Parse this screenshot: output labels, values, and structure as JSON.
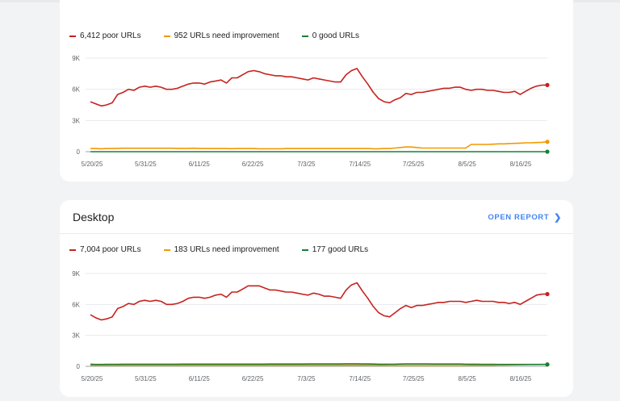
{
  "charts": [
    {
      "id": "mobile",
      "legend": [
        {
          "label": "6,412 poor URLs",
          "color": "#c5221f"
        },
        {
          "label": "952 URLs need improvement",
          "color": "#f29900"
        },
        {
          "label": "0 good URLs",
          "color": "#188038"
        }
      ]
    },
    {
      "id": "desktop",
      "title": "Desktop",
      "open_report": "OPEN REPORT",
      "legend": [
        {
          "label": "7,004 poor URLs",
          "color": "#c5221f"
        },
        {
          "label": "183 URLs need improvement",
          "color": "#f29900"
        },
        {
          "label": "177 good URLs",
          "color": "#188038"
        }
      ]
    }
  ],
  "chart_data": [
    {
      "type": "line",
      "x_ticks": [
        "5/20/25",
        "5/31/25",
        "6/11/25",
        "6/22/25",
        "7/3/25",
        "7/14/25",
        "7/25/25",
        "8/5/25",
        "8/16/25"
      ],
      "y_ticks": [
        "0",
        "3K",
        "6K",
        "9K"
      ],
      "ylim": [
        0,
        9000
      ],
      "series": [
        {
          "name": "6,412 poor URLs",
          "color": "#c5221f",
          "values": [
            4800,
            4600,
            4400,
            4500,
            4700,
            5500,
            5700,
            6000,
            5900,
            6200,
            6300,
            6200,
            6300,
            6200,
            6000,
            6000,
            6100,
            6300,
            6500,
            6600,
            6600,
            6500,
            6700,
            6800,
            6900,
            6600,
            7100,
            7100,
            7400,
            7700,
            7800,
            7700,
            7500,
            7400,
            7300,
            7300,
            7200,
            7200,
            7100,
            7000,
            6900,
            7100,
            7000,
            6900,
            6800,
            6700,
            6700,
            7400,
            7800,
            8000,
            7200,
            6500,
            5700,
            5100,
            4800,
            4700,
            5000,
            5200,
            5600,
            5500,
            5700,
            5700,
            5800,
            5900,
            6000,
            6100,
            6100,
            6200,
            6200,
            6000,
            5900,
            6000,
            6000,
            5900,
            5900,
            5800,
            5700,
            5700,
            5800,
            5500,
            5800,
            6100,
            6300,
            6400,
            6412
          ]
        },
        {
          "name": "952 URLs need improvement",
          "color": "#f29900",
          "values": [
            300,
            300,
            280,
            300,
            300,
            320,
            330,
            330,
            330,
            330,
            330,
            330,
            330,
            330,
            330,
            330,
            320,
            320,
            320,
            330,
            320,
            300,
            300,
            300,
            300,
            300,
            290,
            300,
            300,
            300,
            300,
            280,
            280,
            280,
            280,
            280,
            300,
            300,
            300,
            300,
            300,
            300,
            300,
            300,
            300,
            300,
            300,
            300,
            300,
            300,
            300,
            300,
            280,
            280,
            300,
            300,
            350,
            400,
            450,
            450,
            400,
            350,
            350,
            350,
            350,
            350,
            350,
            350,
            350,
            350,
            700,
            700,
            700,
            700,
            720,
            750,
            750,
            780,
            800,
            820,
            850,
            850,
            880,
            900,
            952
          ]
        },
        {
          "name": "0 good URLs",
          "color": "#188038",
          "values": [
            0,
            0,
            0,
            0,
            0,
            0,
            0,
            0,
            0,
            0,
            0,
            0,
            0,
            0,
            0,
            0,
            0,
            0,
            0,
            0,
            0,
            0,
            0,
            0,
            0,
            0,
            0,
            0,
            0,
            0,
            0,
            0,
            0,
            0,
            0,
            0,
            0,
            0,
            0,
            0,
            0,
            0,
            0,
            0,
            0,
            0,
            0,
            0,
            0,
            0,
            0,
            0,
            0,
            0,
            0,
            0,
            0,
            0,
            0,
            0,
            0,
            0,
            0,
            0,
            0,
            0,
            0,
            0,
            0,
            0,
            0,
            0,
            0,
            0,
            0,
            0,
            0,
            0,
            0,
            0,
            0,
            0,
            0,
            0,
            0
          ]
        }
      ]
    },
    {
      "type": "line",
      "x_ticks": [
        "5/20/25",
        "5/31/25",
        "6/11/25",
        "6/22/25",
        "7/3/25",
        "7/14/25",
        "7/25/25",
        "8/5/25",
        "8/16/25"
      ],
      "y_ticks": [
        "0",
        "3K",
        "6K",
        "9K"
      ],
      "ylim": [
        0,
        9000
      ],
      "series": [
        {
          "name": "7,004 poor URLs",
          "color": "#c5221f",
          "values": [
            5000,
            4700,
            4500,
            4600,
            4800,
            5600,
            5800,
            6100,
            6000,
            6300,
            6400,
            6300,
            6400,
            6300,
            6000,
            6000,
            6100,
            6300,
            6600,
            6700,
            6700,
            6600,
            6700,
            6900,
            7000,
            6700,
            7200,
            7200,
            7500,
            7800,
            7800,
            7800,
            7600,
            7400,
            7400,
            7300,
            7200,
            7200,
            7100,
            7000,
            6900,
            7100,
            7000,
            6800,
            6800,
            6700,
            6600,
            7400,
            7900,
            8100,
            7300,
            6600,
            5800,
            5200,
            4900,
            4800,
            5200,
            5600,
            5900,
            5700,
            5900,
            5900,
            6000,
            6100,
            6200,
            6200,
            6300,
            6300,
            6300,
            6200,
            6300,
            6400,
            6300,
            6300,
            6300,
            6200,
            6200,
            6100,
            6200,
            6000,
            6300,
            6600,
            6900,
            7000,
            7004
          ]
        },
        {
          "name": "183 URLs need improvement",
          "color": "#f29900",
          "values": [
            100,
            100,
            100,
            100,
            100,
            100,
            100,
            100,
            100,
            100,
            100,
            100,
            100,
            100,
            100,
            100,
            100,
            100,
            100,
            100,
            100,
            100,
            100,
            100,
            100,
            100,
            100,
            100,
            100,
            100,
            100,
            100,
            100,
            100,
            100,
            100,
            100,
            100,
            100,
            100,
            100,
            100,
            100,
            100,
            100,
            100,
            100,
            100,
            100,
            100,
            100,
            100,
            100,
            100,
            100,
            80,
            80,
            80,
            80,
            80,
            80,
            80,
            80,
            80,
            80,
            80,
            80,
            80,
            80,
            80,
            100,
            100,
            100,
            100,
            100,
            120,
            120,
            130,
            140,
            150,
            160,
            170,
            175,
            180,
            183
          ]
        },
        {
          "name": "177 good URLs",
          "color": "#188038",
          "values": [
            200,
            180,
            180,
            190,
            190,
            190,
            200,
            200,
            200,
            200,
            200,
            200,
            200,
            200,
            200,
            200,
            200,
            210,
            210,
            210,
            210,
            210,
            210,
            210,
            210,
            210,
            210,
            210,
            210,
            210,
            210,
            210,
            210,
            220,
            220,
            220,
            220,
            220,
            220,
            220,
            230,
            230,
            230,
            230,
            230,
            230,
            230,
            240,
            240,
            240,
            230,
            230,
            220,
            200,
            200,
            200,
            200,
            220,
            230,
            230,
            230,
            230,
            230,
            220,
            220,
            220,
            220,
            220,
            220,
            200,
            200,
            200,
            190,
            190,
            190,
            180,
            180,
            180,
            180,
            180,
            180,
            180,
            180,
            177,
            177
          ]
        }
      ]
    }
  ]
}
